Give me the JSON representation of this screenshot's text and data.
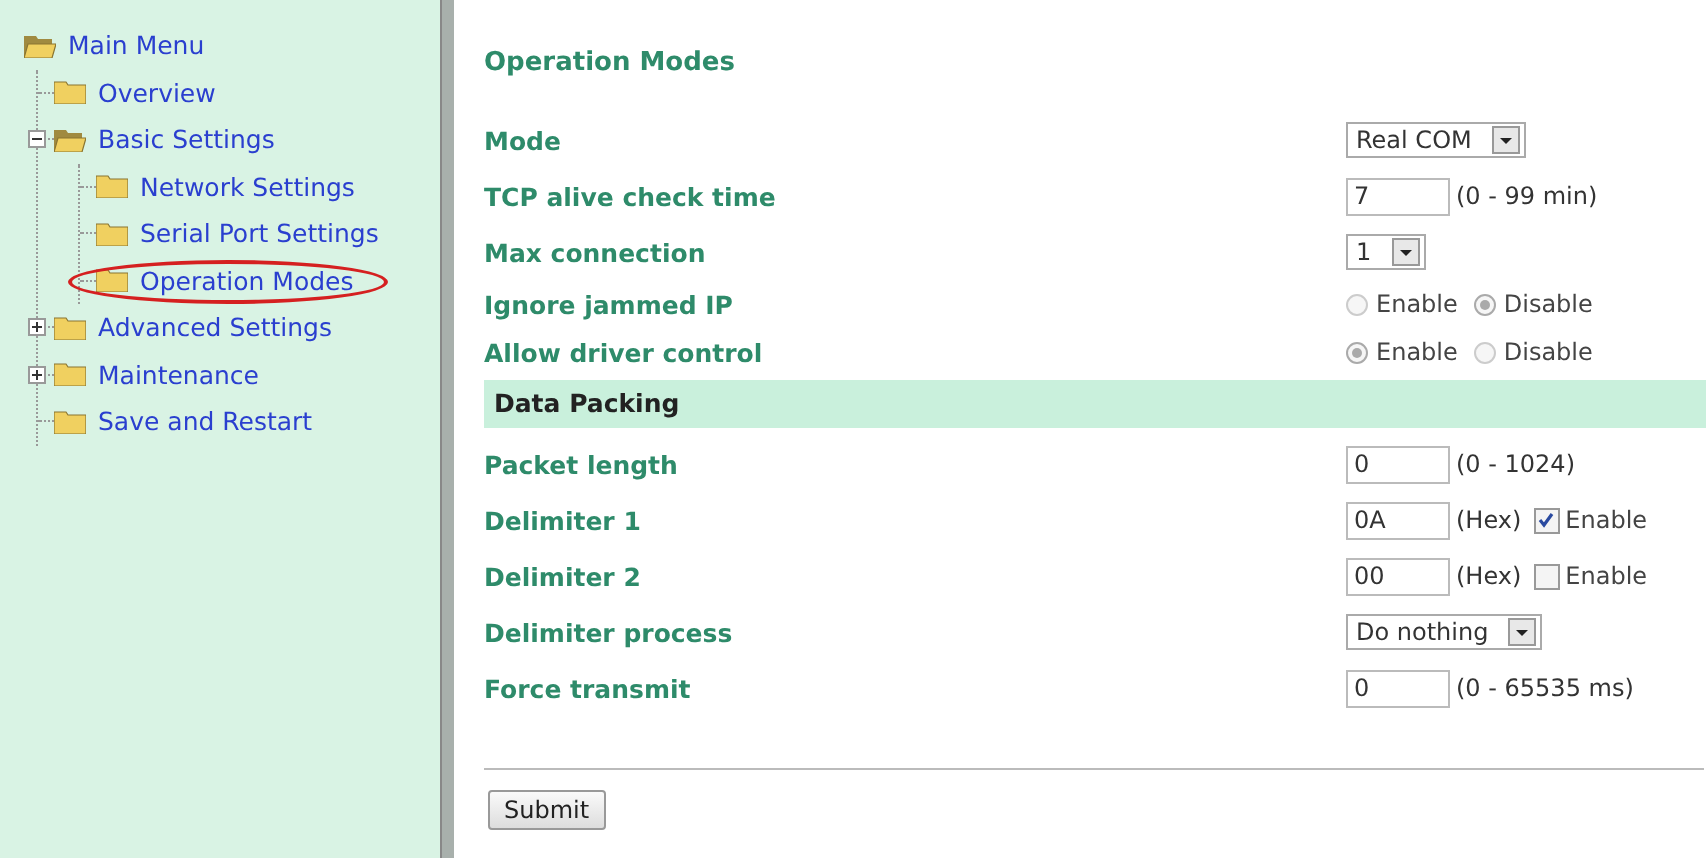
{
  "sidebar": {
    "root": {
      "label": "Main Menu",
      "children": [
        {
          "label": "Overview"
        },
        {
          "label": "Basic Settings",
          "expanded": true,
          "children": [
            {
              "label": "Network Settings",
              "selected": false
            },
            {
              "label": "Serial Port Settings",
              "selected": false
            },
            {
              "label": "Operation Modes",
              "selected": true
            }
          ]
        },
        {
          "label": "Advanced Settings",
          "expanded": false
        },
        {
          "label": "Maintenance",
          "expanded": false
        },
        {
          "label": "Save and Restart"
        }
      ]
    }
  },
  "form": {
    "title": "Operation Modes",
    "rows": [
      {
        "kind": "select",
        "label": "Mode",
        "value": "Real COM"
      },
      {
        "kind": "text",
        "label": "TCP alive check time",
        "value": "7",
        "hint": "(0 - 99 min)"
      },
      {
        "kind": "select",
        "label": "Max connection",
        "value": "1"
      },
      {
        "kind": "radio",
        "label": "Ignore jammed IP",
        "options": [
          {
            "label": "Enable",
            "selected": false
          },
          {
            "label": "Disable",
            "selected": true
          }
        ]
      },
      {
        "kind": "radio",
        "label": "Allow driver control",
        "options": [
          {
            "label": "Enable",
            "selected": true
          },
          {
            "label": "Disable",
            "selected": false
          }
        ]
      },
      {
        "kind": "section",
        "label": "Data Packing"
      },
      {
        "kind": "text",
        "label": "Packet length",
        "value": "0",
        "hint": "(0 - 1024)"
      },
      {
        "kind": "text",
        "label": "Delimiter 1",
        "value": "0A",
        "hint": "(Hex)",
        "checkbox": {
          "label": "Enable",
          "checked": true
        }
      },
      {
        "kind": "text",
        "label": "Delimiter 2",
        "value": "00",
        "hint": "(Hex)",
        "checkbox": {
          "label": "Enable",
          "checked": false
        }
      },
      {
        "kind": "select",
        "label": "Delimiter process",
        "value": "Do nothing"
      },
      {
        "kind": "text",
        "label": "Force transmit",
        "value": "0",
        "hint": "(0 - 65535 ms)"
      }
    ],
    "submit": "Submit"
  }
}
